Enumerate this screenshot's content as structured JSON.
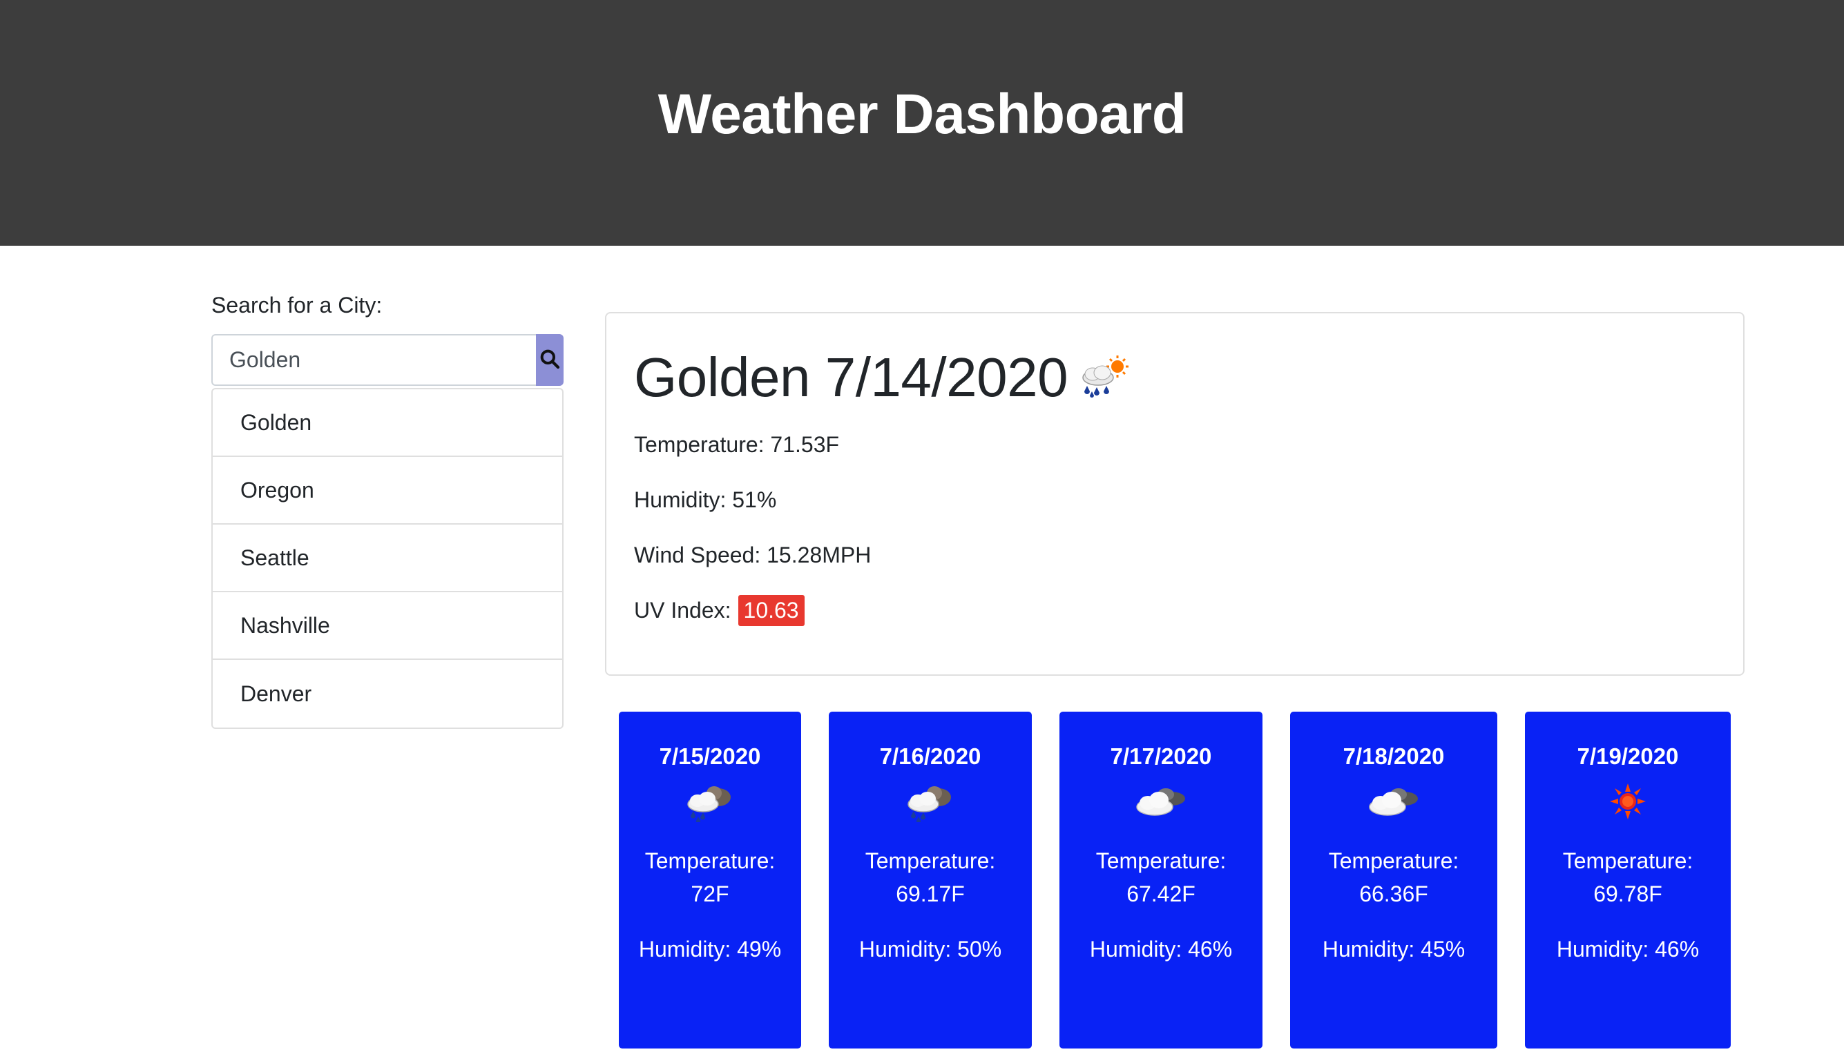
{
  "header": {
    "title": "Weather Dashboard"
  },
  "search": {
    "label": "Search for a City:",
    "value": "Golden",
    "button_icon": "search-icon"
  },
  "cities": [
    "Golden",
    "Oregon",
    "Seattle",
    "Nashville",
    "Denver"
  ],
  "current": {
    "title": "Golden 7/14/2020",
    "icon": "rain-sun-icon",
    "temperature": "Temperature: 71.53F",
    "humidity": "Humidity: 51%",
    "wind": "Wind Speed: 15.28MPH",
    "uv_label": "UV Index:",
    "uv_value": "10.63",
    "uv_color": "#e8382f"
  },
  "forecast": [
    {
      "date": "7/15/2020",
      "icon": "rain-cloud-icon",
      "temp": "Temperature: 72F",
      "humidity": "Humidity: 49%"
    },
    {
      "date": "7/16/2020",
      "icon": "rain-cloud-icon",
      "temp": "Temperature: 69.17F",
      "humidity": "Humidity: 50%"
    },
    {
      "date": "7/17/2020",
      "icon": "cloud-icon",
      "temp": "Temperature: 67.42F",
      "humidity": "Humidity: 46%"
    },
    {
      "date": "7/18/2020",
      "icon": "cloud-icon",
      "temp": "Temperature: 66.36F",
      "humidity": "Humidity: 45%"
    },
    {
      "date": "7/19/2020",
      "icon": "sun-icon",
      "temp": "Temperature: 69.78F",
      "humidity": "Humidity: 46%"
    }
  ],
  "colors": {
    "header_bg": "#3d3d3d",
    "forecast_bg": "#0922f5",
    "search_button": "#8c8fd6"
  }
}
